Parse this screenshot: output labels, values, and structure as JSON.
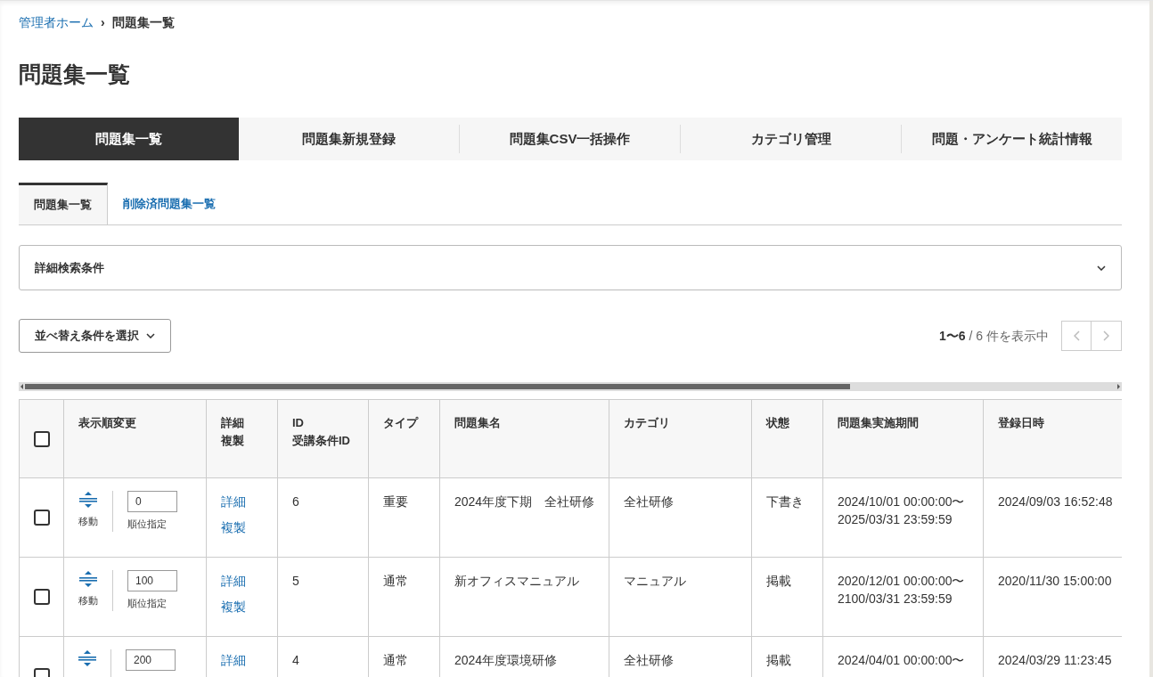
{
  "breadcrumb": {
    "home": "管理者ホーム",
    "separator": "›",
    "current": "問題集一覧"
  },
  "title": "問題集一覧",
  "main_tabs": [
    {
      "label": "問題集一覧",
      "selected": true
    },
    {
      "label": "問題集新規登録",
      "selected": false
    },
    {
      "label": "問題集CSV一括操作",
      "selected": false
    },
    {
      "label": "カテゴリ管理",
      "selected": false
    },
    {
      "label": "問題・アンケート統計情報",
      "selected": false
    }
  ],
  "sub_tabs": [
    {
      "label": "問題集一覧",
      "selected": true
    },
    {
      "label": "削除済問題集一覧",
      "selected": false
    }
  ],
  "search_panel": {
    "label": "詳細検索条件",
    "expanded": false
  },
  "sort_button": "並べ替え条件を選択",
  "pagination": {
    "range": "1〜6",
    "total": " / 6 件を表示中"
  },
  "table": {
    "columns": [
      [
        "表示順変更"
      ],
      [
        "詳細",
        "複製"
      ],
      [
        "ID",
        "受講条件ID"
      ],
      [
        "タイプ"
      ],
      [
        "問題集名"
      ],
      [
        "カテゴリ"
      ],
      [
        "状態"
      ],
      [
        "問題集実施期間"
      ],
      [
        "登録日時"
      ]
    ],
    "header_checked": false,
    "rows": [
      {
        "checked": false,
        "move": "移動",
        "order": "0",
        "order_label": "順位指定",
        "links": [
          "詳細",
          "複製"
        ],
        "id": "6",
        "type": "重要",
        "name": "2024年度下期　全社研修",
        "category": "全社研修",
        "status": "下書き",
        "period": [
          "2024/10/01 00:00:00〜",
          "2025/03/31 23:59:59"
        ],
        "registered": "2024/09/03 16:52:48"
      },
      {
        "checked": false,
        "move": "移動",
        "order": "100",
        "order_label": "順位指定",
        "links": [
          "詳細",
          "複製"
        ],
        "id": "5",
        "type": "通常",
        "name": "新オフィスマニュアル",
        "category": "マニュアル",
        "status": "掲載",
        "period": [
          "2020/12/01 00:00:00〜",
          "2100/03/31 23:59:59"
        ],
        "registered": "2020/11/30 15:00:00"
      },
      {
        "checked": false,
        "order": "200",
        "links": [
          "詳細"
        ],
        "id": "4",
        "type": "通常",
        "name": "2024年度環境研修",
        "category": "全社研修",
        "status": "掲載",
        "period": [
          "2024/04/01 00:00:00〜"
        ],
        "registered": "2024/03/29 11:23:45"
      }
    ]
  }
}
